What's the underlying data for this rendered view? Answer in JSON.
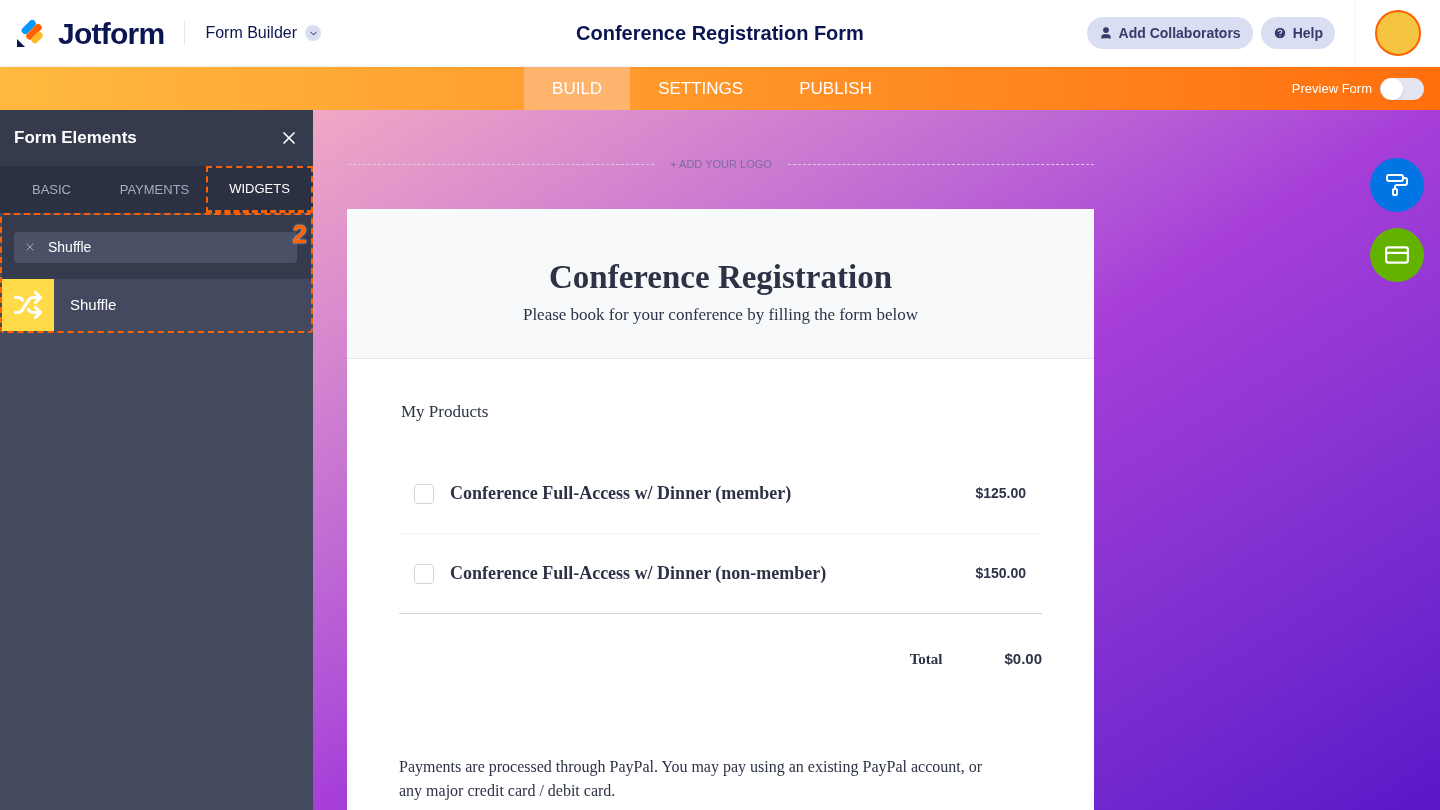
{
  "header": {
    "brand": "Jotform",
    "section": "Form Builder",
    "title": "Conference Registration Form",
    "buttons": [
      {
        "kind": "collaborators",
        "label": "Add Collaborators"
      },
      {
        "kind": "help",
        "label": "Help"
      }
    ]
  },
  "nav": {
    "tabs": [
      {
        "label": "BUILD",
        "selected": true
      },
      {
        "label": "SETTINGS",
        "selected": false
      },
      {
        "label": "PUBLISH",
        "selected": false
      }
    ],
    "preview": {
      "label": "Preview Form",
      "on": false
    }
  },
  "sidebar": {
    "title": "Form Elements",
    "tabs": [
      {
        "label": "BASIC",
        "selected": false
      },
      {
        "label": "PAYMENTS",
        "selected": false
      },
      {
        "label": "WIDGETS",
        "selected": true
      }
    ],
    "search": {
      "value": "Shuffle"
    },
    "results": [
      {
        "label": "Shuffle"
      }
    ],
    "annotation": "2"
  },
  "form": {
    "logo_hint": "+ ADD YOUR LOGO",
    "title": "Conference Registration",
    "subtitle": "Please book for your conference by filling the form below",
    "section_label": "My Products",
    "products": [
      {
        "name": "Conference Full-Access w/ Dinner (member)",
        "price": "$125.00",
        "checked": false
      },
      {
        "name": "Conference Full-Access w/ Dinner (non-member)",
        "price": "$150.00",
        "checked": false
      }
    ],
    "total_label": "Total",
    "total": "$0.00",
    "note": "Payments are processed through PayPal.  You may pay using an existing PayPal account, or any major credit card / debit card."
  }
}
